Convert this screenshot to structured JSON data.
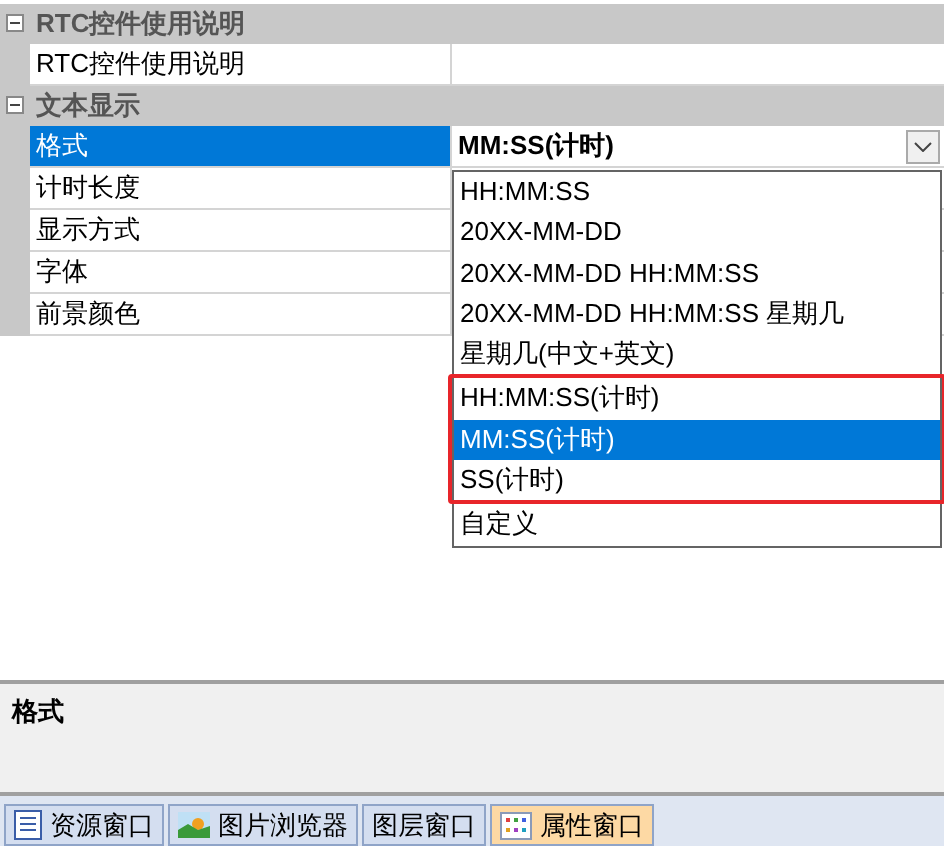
{
  "property_grid": {
    "categories": [
      {
        "title": "RTC控件使用说明",
        "expanded": true,
        "rows": [
          {
            "name": "RTC控件使用说明",
            "value": "",
            "selected": false
          }
        ]
      },
      {
        "title": "文本显示",
        "expanded": true,
        "rows": [
          {
            "name": "格式",
            "value": "MM:SS(计时)",
            "selected": true
          },
          {
            "name": "计时长度",
            "value": "",
            "selected": false
          },
          {
            "name": "显示方式",
            "value": "",
            "selected": false
          },
          {
            "name": "字体",
            "value": "",
            "selected": false
          },
          {
            "name": "前景颜色",
            "value": "",
            "selected": false
          }
        ]
      }
    ]
  },
  "dropdown": {
    "options": [
      {
        "label": "HH:MM:SS",
        "selected": false,
        "highlighted": false
      },
      {
        "label": "20XX-MM-DD",
        "selected": false,
        "highlighted": false
      },
      {
        "label": "20XX-MM-DD HH:MM:SS",
        "selected": false,
        "highlighted": false
      },
      {
        "label": "20XX-MM-DD HH:MM:SS 星期几",
        "selected": false,
        "highlighted": false
      },
      {
        "label": "星期几(中文+英文)",
        "selected": false,
        "highlighted": false
      },
      {
        "label": "HH:MM:SS(计时)",
        "selected": false,
        "highlighted": true
      },
      {
        "label": "MM:SS(计时)",
        "selected": true,
        "highlighted": true
      },
      {
        "label": "SS(计时)",
        "selected": false,
        "highlighted": true
      },
      {
        "label": "自定义",
        "selected": false,
        "highlighted": false
      }
    ]
  },
  "description": {
    "title": "格式"
  },
  "tabs": [
    {
      "label": "资源窗口",
      "kind": "document",
      "selected": false
    },
    {
      "label": "图片浏览器",
      "kind": "image",
      "selected": false
    },
    {
      "label": "图层窗口",
      "kind": "plain",
      "selected": false
    },
    {
      "label": "属性窗口",
      "kind": "grid",
      "selected": true
    }
  ]
}
